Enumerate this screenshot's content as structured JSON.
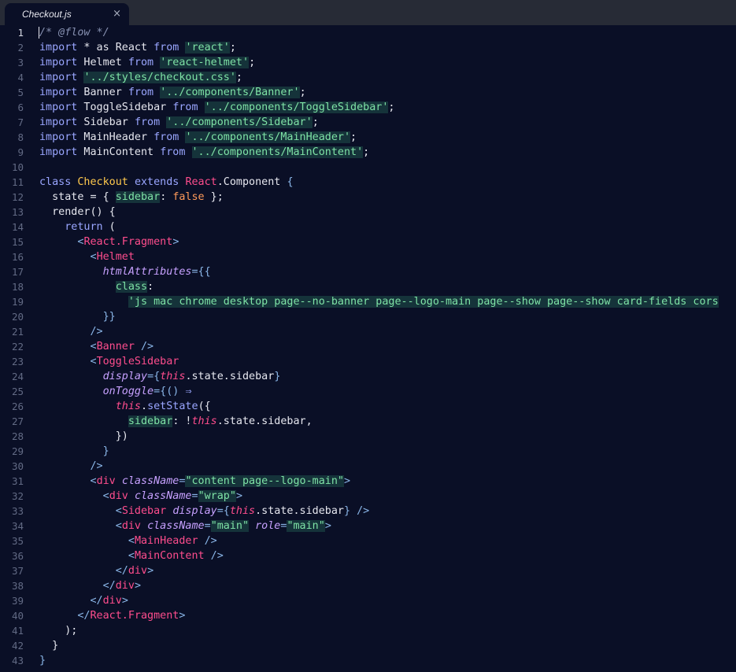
{
  "tab": {
    "title": "Checkout.js",
    "close_glyph": "×"
  },
  "lines": [
    {
      "n": "1"
    },
    {
      "n": "2"
    },
    {
      "n": "3"
    },
    {
      "n": "4"
    },
    {
      "n": "5"
    },
    {
      "n": "6"
    },
    {
      "n": "7"
    },
    {
      "n": "8"
    },
    {
      "n": "9"
    },
    {
      "n": "10"
    },
    {
      "n": "11"
    },
    {
      "n": "12"
    },
    {
      "n": "13"
    },
    {
      "n": "14"
    },
    {
      "n": "15"
    },
    {
      "n": "16"
    },
    {
      "n": "17"
    },
    {
      "n": "18"
    },
    {
      "n": "19"
    },
    {
      "n": "20"
    },
    {
      "n": "21"
    },
    {
      "n": "22"
    },
    {
      "n": "23"
    },
    {
      "n": "24"
    },
    {
      "n": "25"
    },
    {
      "n": "26"
    },
    {
      "n": "27"
    },
    {
      "n": "28"
    },
    {
      "n": "29"
    },
    {
      "n": "30"
    },
    {
      "n": "31"
    },
    {
      "n": "32"
    },
    {
      "n": "33"
    },
    {
      "n": "34"
    },
    {
      "n": "35"
    },
    {
      "n": "36"
    },
    {
      "n": "37"
    },
    {
      "n": "38"
    },
    {
      "n": "39"
    },
    {
      "n": "40"
    },
    {
      "n": "41"
    },
    {
      "n": "42"
    },
    {
      "n": "43"
    }
  ],
  "code": {
    "l1": "/* @flow */",
    "l2": [
      "import",
      " * as React ",
      "from",
      " ",
      "'react'",
      ";"
    ],
    "l3": [
      "import",
      " Helmet ",
      "from",
      " ",
      "'react-helmet'",
      ";"
    ],
    "l4": [
      "import",
      " ",
      "'../styles/checkout.css'",
      ";"
    ],
    "l5": [
      "import",
      " Banner ",
      "from",
      " ",
      "'../components/Banner'",
      ";"
    ],
    "l6": [
      "import",
      " ToggleSidebar ",
      "from",
      " ",
      "'../components/ToggleSidebar'",
      ";"
    ],
    "l7": [
      "import",
      " Sidebar ",
      "from",
      " ",
      "'../components/Sidebar'",
      ";"
    ],
    "l8": [
      "import",
      " MainHeader ",
      "from",
      " ",
      "'../components/MainHeader'",
      ";"
    ],
    "l9": [
      "import",
      " MainContent ",
      "from",
      " ",
      "'../components/MainContent'",
      ";"
    ],
    "l11": [
      "class",
      " ",
      "Checkout",
      " ",
      "extends",
      " ",
      "React",
      ".Component ",
      "{"
    ],
    "l12": [
      "  state = { ",
      "sidebar",
      ": ",
      "false",
      " };"
    ],
    "l13": [
      "  render() {"
    ],
    "l14": [
      "    ",
      "return",
      " ("
    ],
    "l15": [
      "      ",
      "<",
      "React.Fragment",
      ">"
    ],
    "l16": [
      "        ",
      "<",
      "Helmet"
    ],
    "l17": [
      "          ",
      "htmlAttributes",
      "={{"
    ],
    "l18": [
      "            ",
      "class",
      ":"
    ],
    "l19": [
      "              ",
      "'js mac chrome desktop page--no-banner page--logo-main page--show page--show card-fields cors"
    ],
    "l20": [
      "          ",
      "}}"
    ],
    "l21": [
      "        ",
      "/>"
    ],
    "l22": [
      "        ",
      "<",
      "Banner",
      " />"
    ],
    "l23": [
      "        ",
      "<",
      "ToggleSidebar"
    ],
    "l24": [
      "          ",
      "display",
      "={",
      "this",
      ".state.sidebar",
      "}"
    ],
    "l25": [
      "          ",
      "onToggle",
      "={() ",
      "⇒"
    ],
    "l26": [
      "            ",
      "this",
      ".",
      "setState",
      "({"
    ],
    "l27": [
      "              ",
      "sidebar",
      ": !",
      "this",
      ".state.sidebar,"
    ],
    "l28": [
      "            })"
    ],
    "l29": [
      "          ",
      "}"
    ],
    "l30": [
      "        ",
      "/>"
    ],
    "l31": [
      "        ",
      "<",
      "div",
      " ",
      "className",
      "=",
      "\"content page--logo-main\"",
      ">"
    ],
    "l32": [
      "          ",
      "<",
      "div",
      " ",
      "className",
      "=",
      "\"wrap\"",
      ">"
    ],
    "l33": [
      "            ",
      "<",
      "Sidebar",
      " ",
      "display",
      "={",
      "this",
      ".state.sidebar",
      "} />"
    ],
    "l34": [
      "            ",
      "<",
      "div",
      " ",
      "className",
      "=",
      "\"main\"",
      " ",
      "role",
      "=",
      "\"main\"",
      ">"
    ],
    "l35": [
      "              ",
      "<",
      "MainHeader",
      " />"
    ],
    "l36": [
      "              ",
      "<",
      "MainContent",
      " />"
    ],
    "l37": [
      "            ",
      "</",
      "div",
      ">"
    ],
    "l38": [
      "          ",
      "</",
      "div",
      ">"
    ],
    "l39": [
      "        ",
      "</",
      "div",
      ">"
    ],
    "l40": [
      "      ",
      "</",
      "React.Fragment",
      ">"
    ],
    "l41": [
      "    );"
    ],
    "l42": [
      "  }"
    ],
    "l43": [
      "}"
    ]
  }
}
